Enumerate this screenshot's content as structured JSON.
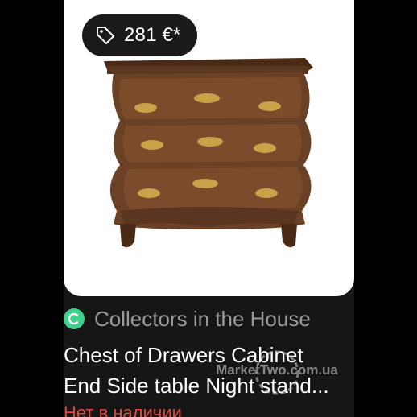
{
  "listing": {
    "price": "281 €*",
    "seller": {
      "name": "Collectors in the House",
      "avatar_letter": "C",
      "avatar_color": "#3fd28c"
    },
    "title_line1": "Chest of Drawers Cabinet",
    "title_line2": "End Side table Night stand...",
    "status": "Нет в наличии"
  },
  "watermark": {
    "text": "MarketTwo.com.ua"
  },
  "colors": {
    "background": "#000000",
    "card": "#161616",
    "seller_text": "#9a9a9a",
    "status": "#d94a3e"
  },
  "icons": {
    "price": "price-tag-icon"
  }
}
